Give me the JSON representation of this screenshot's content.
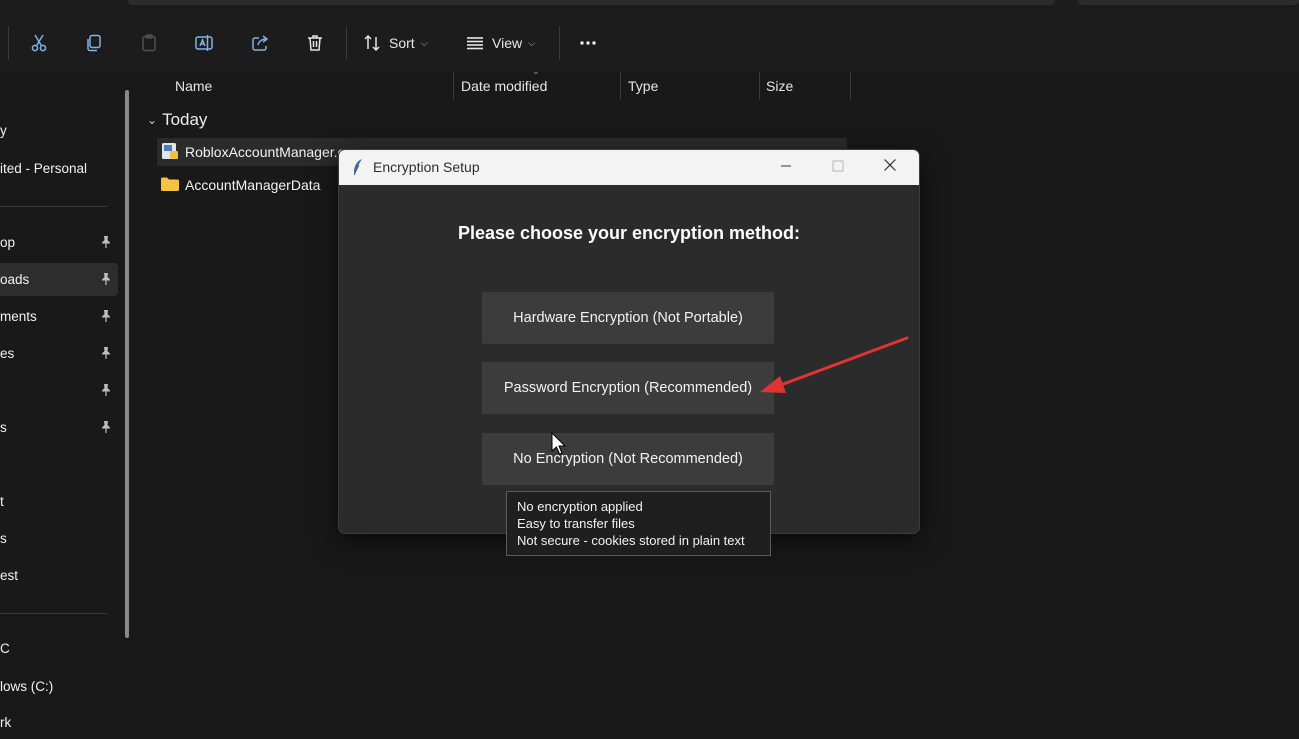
{
  "toolbar": {
    "sort_label": "Sort",
    "view_label": "View",
    "buttons": [
      "scissors-icon",
      "copy-icon",
      "paste-icon",
      "rename-icon",
      "share-icon",
      "trash-icon",
      "sort-icon",
      "view-icon",
      "more-icon"
    ]
  },
  "nav": {
    "items": [
      {
        "label": "y"
      },
      {
        "label": "ited - Personal"
      },
      {
        "label": "op"
      },
      {
        "label": "oads"
      },
      {
        "label": "ments"
      },
      {
        "label": "es"
      },
      {
        "label": ""
      },
      {
        "label": "s"
      },
      {
        "label": "t"
      },
      {
        "label": "s"
      },
      {
        "label": "est"
      },
      {
        "label": "C"
      },
      {
        "label": "lows (C:)"
      },
      {
        "label": "rk"
      }
    ]
  },
  "columns": {
    "name": "Name",
    "date_modified": "Date modified",
    "type": "Type",
    "size": "Size"
  },
  "group": {
    "label": "Today"
  },
  "files": [
    {
      "name": "RobloxAccountManager.e",
      "icon": "app-file-icon"
    },
    {
      "name": "AccountManagerData",
      "icon": "folder-icon"
    }
  ],
  "dialog": {
    "title": "Encryption Setup",
    "heading": "Please choose your encryption method:",
    "options": [
      {
        "label": "Hardware Encryption (Not Portable)"
      },
      {
        "label": "Password Encryption (Recommended)"
      },
      {
        "label": "No Encryption (Not Recommended)"
      }
    ]
  },
  "tooltip": {
    "lines": [
      "No encryption applied",
      "Easy to transfer files",
      "Not secure - cookies stored in plain text"
    ]
  },
  "colors": {
    "background": "#191919",
    "dialog_body": "#2b2b2b",
    "dialog_titlebar": "#f3f3f3",
    "button": "#3c3c3c",
    "annotation_arrow": "#e03434",
    "folder": "#f5c242"
  }
}
